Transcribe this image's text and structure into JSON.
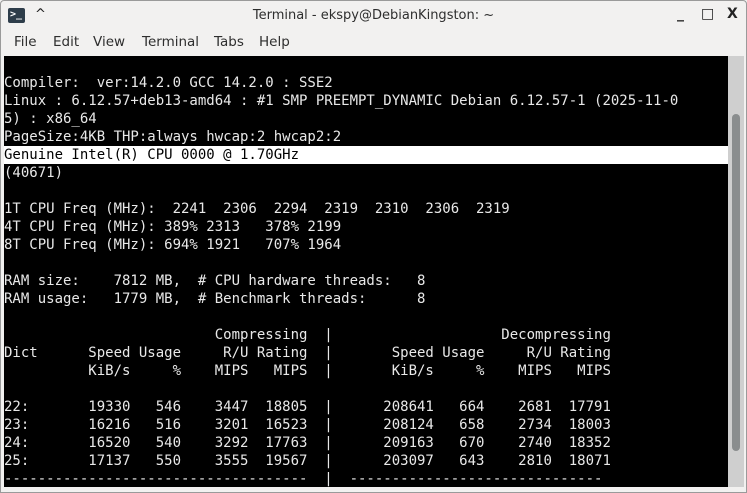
{
  "window": {
    "title": "Terminal - ekspy@DebianKingston: ~",
    "icon": "terminal-icon",
    "icon_glyph": ">_",
    "shade_glyph": "^",
    "minimize_glyph": "_",
    "maximize_glyph": "□",
    "close_glyph": "X"
  },
  "menu": [
    "File",
    "Edit",
    "View",
    "Terminal",
    "Tabs",
    "Help"
  ],
  "terminal": {
    "highlighted_line": 5,
    "lines": [
      "",
      "Compiler:  ver:14.2.0 GCC 14.2.0 : SSE2",
      "Linux : 6.12.57+deb13-amd64 : #1 SMP PREEMPT_DYNAMIC Debian 6.12.57-1 (2025-11-0",
      "5) : x86_64",
      "PageSize:4KB THP:always hwcap:2 hwcap2:2",
      "Genuine Intel(R) CPU 0000 @ 1.70GHz",
      "(40671)",
      "",
      "1T CPU Freq (MHz):  2241  2306  2294  2319  2310  2306  2319",
      "4T CPU Freq (MHz): 389% 2313   378% 2199",
      "8T CPU Freq (MHz): 694% 1921   707% 1964",
      "",
      "RAM size:    7812 MB,  # CPU hardware threads:   8",
      "RAM usage:   1779 MB,  # Benchmark threads:      8",
      "",
      "                         Compressing  |                    Decompressing",
      "Dict      Speed Usage     R/U Rating  |       Speed Usage     R/U Rating",
      "          KiB/s     %    MIPS   MIPS  |       KiB/s     %    MIPS   MIPS",
      "",
      "22:       19330   546    3447  18805  |      208641   664    2681  17791",
      "23:       16216   516    3201  16523  |      208124   658    2734  18003",
      "24:       16520   540    3292  17763  |      209163   670    2740  18352",
      "25:       17137   550    3555  19567  |      203097   643    2810  18071",
      "------------------------------------  |  ------------------------------"
    ]
  },
  "colors": {
    "terminal_bg": "#000000",
    "terminal_fg": "#e8e8e8",
    "selection_bg": "#ffffff"
  }
}
